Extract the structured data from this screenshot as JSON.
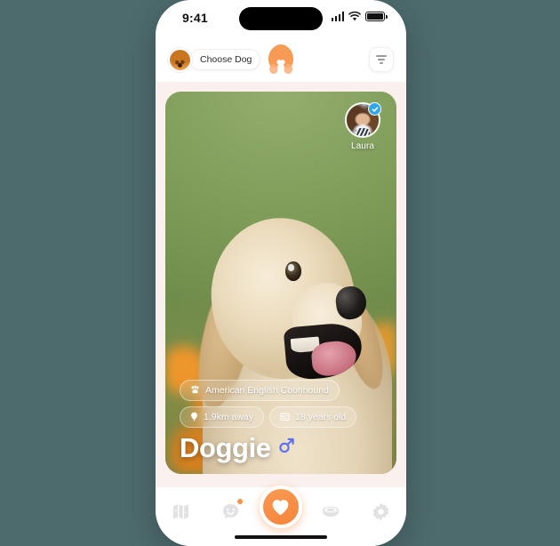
{
  "status_bar": {
    "time": "9:41",
    "cellular_icon": "cellular-bars-icon",
    "wifi_icon": "wifi-icon",
    "battery_icon": "battery-full-icon"
  },
  "header": {
    "avatar_icon": "dog-avatar",
    "choose_label": "Choose Dog",
    "logo_icon": "app-logo-heart-paw",
    "filter_icon": "filter-icon"
  },
  "card": {
    "photo_alt": "golden-retriever-puppy",
    "owner": {
      "name": "Laura",
      "avatar_icon": "owner-avatar",
      "verified_icon": "verified-badge-icon"
    },
    "pills": [
      {
        "icon": "paw-icon",
        "label": "American English Coonhound"
      },
      {
        "icon": "location-pin-icon",
        "label": "1.9km away"
      },
      {
        "icon": "calendar-icon",
        "label": "18 years old"
      }
    ],
    "dog_name": "Doggie",
    "gender_icon": "male-gender-icon",
    "gender_color": "#5b6ef5"
  },
  "tabbar": {
    "items": [
      {
        "icon": "map-icon",
        "label": "Map",
        "active": false,
        "badge": false
      },
      {
        "icon": "chat-icon",
        "label": "Chat",
        "active": false,
        "badge": true
      },
      {
        "icon": "heart-icon",
        "label": "Discover",
        "active": true,
        "badge": false
      },
      {
        "icon": "bowl-icon",
        "label": "Food",
        "active": false,
        "badge": false
      },
      {
        "icon": "gear-icon",
        "label": "Settings",
        "active": false,
        "badge": false
      }
    ]
  },
  "colors": {
    "background": "#4d6a6d",
    "accent": "#f5843a",
    "app_bg": "#faf0ed",
    "verified_blue": "#2fa7e8",
    "inactive_icon": "#e2e2e4"
  }
}
